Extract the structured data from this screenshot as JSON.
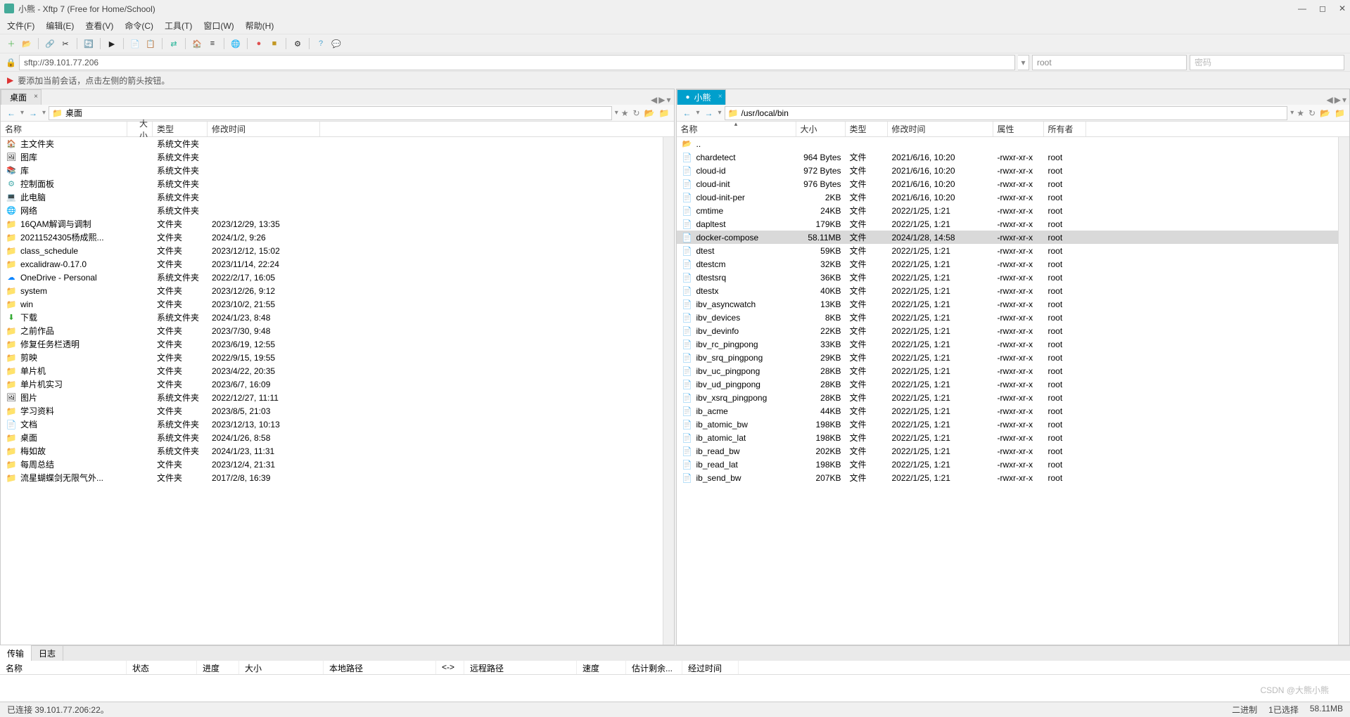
{
  "title": "小熊 - Xftp 7 (Free for Home/School)",
  "menu": [
    "文件(F)",
    "编辑(E)",
    "查看(V)",
    "命令(C)",
    "工具(T)",
    "窗口(W)",
    "帮助(H)"
  ],
  "address": {
    "value": "sftp://39.101.77.206",
    "user": "root",
    "password": "密码"
  },
  "tip": "要添加当前会话，点击左侧的箭头按钮。",
  "left": {
    "tab": "桌面",
    "path_display": "桌面",
    "cols": {
      "name": "名称",
      "size": "大小",
      "type": "类型",
      "mod": "修改时间"
    },
    "rows": [
      {
        "icon": "fi-home",
        "name": "主文件夹",
        "type": "系统文件夹",
        "mod": ""
      },
      {
        "icon": "fi-pic",
        "name": "图库",
        "type": "系统文件夹",
        "mod": ""
      },
      {
        "icon": "fi-lib",
        "name": "库",
        "type": "系统文件夹",
        "mod": ""
      },
      {
        "icon": "fi-panel",
        "name": "控制面板",
        "type": "系统文件夹",
        "mod": ""
      },
      {
        "icon": "fi-pc",
        "name": "此电脑",
        "type": "系统文件夹",
        "mod": ""
      },
      {
        "icon": "fi-net",
        "name": "网络",
        "type": "系统文件夹",
        "mod": ""
      },
      {
        "icon": "fi-folder",
        "name": "16QAM解调与调制",
        "type": "文件夹",
        "mod": "2023/12/29, 13:35"
      },
      {
        "icon": "fi-folder",
        "name": "20211524305杨成熙...",
        "type": "文件夹",
        "mod": "2024/1/2, 9:26"
      },
      {
        "icon": "fi-folder",
        "name": "class_schedule",
        "type": "文件夹",
        "mod": "2023/12/12, 15:02"
      },
      {
        "icon": "fi-folder",
        "name": "excalidraw-0.17.0",
        "type": "文件夹",
        "mod": "2023/11/14, 22:24"
      },
      {
        "icon": "fi-cloud",
        "name": "OneDrive - Personal",
        "type": "系统文件夹",
        "mod": "2022/2/17, 16:05"
      },
      {
        "icon": "fi-folder",
        "name": "system",
        "type": "文件夹",
        "mod": "2023/12/26, 9:12"
      },
      {
        "icon": "fi-folder",
        "name": "win",
        "type": "文件夹",
        "mod": "2023/10/2, 21:55"
      },
      {
        "icon": "fi-down",
        "name": "下载",
        "type": "系统文件夹",
        "mod": "2024/1/23, 8:48"
      },
      {
        "icon": "fi-folder",
        "name": "之前作品",
        "type": "文件夹",
        "mod": "2023/7/30, 9:48"
      },
      {
        "icon": "fi-folder",
        "name": "修复任务栏透明",
        "type": "文件夹",
        "mod": "2023/6/19, 12:55"
      },
      {
        "icon": "fi-folder",
        "name": "剪映",
        "type": "文件夹",
        "mod": "2022/9/15, 19:55"
      },
      {
        "icon": "fi-folder",
        "name": "单片机",
        "type": "文件夹",
        "mod": "2023/4/22, 20:35"
      },
      {
        "icon": "fi-folder",
        "name": "单片机实习",
        "type": "文件夹",
        "mod": "2023/6/7, 16:09"
      },
      {
        "icon": "fi-pic",
        "name": "图片",
        "type": "系统文件夹",
        "mod": "2022/12/27, 11:11"
      },
      {
        "icon": "fi-folder",
        "name": "学习资料",
        "type": "文件夹",
        "mod": "2023/8/5, 21:03"
      },
      {
        "icon": "fi-file",
        "name": "文档",
        "type": "系统文件夹",
        "mod": "2023/12/13, 10:13"
      },
      {
        "icon": "fi-folder",
        "name": "桌面",
        "type": "系统文件夹",
        "mod": "2024/1/26, 8:58"
      },
      {
        "icon": "fi-folder",
        "name": "梅如故",
        "type": "系统文件夹",
        "mod": "2024/1/23, 11:31"
      },
      {
        "icon": "fi-folder",
        "name": "每周总结",
        "type": "文件夹",
        "mod": "2023/12/4, 21:31"
      },
      {
        "icon": "fi-folder",
        "name": "流星蝴蝶剑无限气外...",
        "type": "文件夹",
        "mod": "2017/2/8, 16:39"
      }
    ]
  },
  "right": {
    "tab": "小熊",
    "path_display": "/usr/local/bin",
    "cols": {
      "name": "名称",
      "size": "大小",
      "type": "类型",
      "mod": "修改时间",
      "attr": "属性",
      "owner": "所有者"
    },
    "parent": "..",
    "rows": [
      {
        "name": "chardetect",
        "size": "964 Bytes",
        "type": "文件",
        "mod": "2021/6/16, 10:20",
        "attr": "-rwxr-xr-x",
        "owner": "root"
      },
      {
        "name": "cloud-id",
        "size": "972 Bytes",
        "type": "文件",
        "mod": "2021/6/16, 10:20",
        "attr": "-rwxr-xr-x",
        "owner": "root"
      },
      {
        "name": "cloud-init",
        "size": "976 Bytes",
        "type": "文件",
        "mod": "2021/6/16, 10:20",
        "attr": "-rwxr-xr-x",
        "owner": "root"
      },
      {
        "name": "cloud-init-per",
        "size": "2KB",
        "type": "文件",
        "mod": "2021/6/16, 10:20",
        "attr": "-rwxr-xr-x",
        "owner": "root"
      },
      {
        "name": "cmtime",
        "size": "24KB",
        "type": "文件",
        "mod": "2022/1/25, 1:21",
        "attr": "-rwxr-xr-x",
        "owner": "root"
      },
      {
        "name": "dapltest",
        "size": "179KB",
        "type": "文件",
        "mod": "2022/1/25, 1:21",
        "attr": "-rwxr-xr-x",
        "owner": "root"
      },
      {
        "name": "docker-compose",
        "size": "58.11MB",
        "type": "文件",
        "mod": "2024/1/28, 14:58",
        "attr": "-rwxr-xr-x",
        "owner": "root",
        "selected": true
      },
      {
        "name": "dtest",
        "size": "59KB",
        "type": "文件",
        "mod": "2022/1/25, 1:21",
        "attr": "-rwxr-xr-x",
        "owner": "root"
      },
      {
        "name": "dtestcm",
        "size": "32KB",
        "type": "文件",
        "mod": "2022/1/25, 1:21",
        "attr": "-rwxr-xr-x",
        "owner": "root"
      },
      {
        "name": "dtestsrq",
        "size": "36KB",
        "type": "文件",
        "mod": "2022/1/25, 1:21",
        "attr": "-rwxr-xr-x",
        "owner": "root"
      },
      {
        "name": "dtestx",
        "size": "40KB",
        "type": "文件",
        "mod": "2022/1/25, 1:21",
        "attr": "-rwxr-xr-x",
        "owner": "root"
      },
      {
        "name": "ibv_asyncwatch",
        "size": "13KB",
        "type": "文件",
        "mod": "2022/1/25, 1:21",
        "attr": "-rwxr-xr-x",
        "owner": "root"
      },
      {
        "name": "ibv_devices",
        "size": "8KB",
        "type": "文件",
        "mod": "2022/1/25, 1:21",
        "attr": "-rwxr-xr-x",
        "owner": "root"
      },
      {
        "name": "ibv_devinfo",
        "size": "22KB",
        "type": "文件",
        "mod": "2022/1/25, 1:21",
        "attr": "-rwxr-xr-x",
        "owner": "root"
      },
      {
        "name": "ibv_rc_pingpong",
        "size": "33KB",
        "type": "文件",
        "mod": "2022/1/25, 1:21",
        "attr": "-rwxr-xr-x",
        "owner": "root"
      },
      {
        "name": "ibv_srq_pingpong",
        "size": "29KB",
        "type": "文件",
        "mod": "2022/1/25, 1:21",
        "attr": "-rwxr-xr-x",
        "owner": "root"
      },
      {
        "name": "ibv_uc_pingpong",
        "size": "28KB",
        "type": "文件",
        "mod": "2022/1/25, 1:21",
        "attr": "-rwxr-xr-x",
        "owner": "root"
      },
      {
        "name": "ibv_ud_pingpong",
        "size": "28KB",
        "type": "文件",
        "mod": "2022/1/25, 1:21",
        "attr": "-rwxr-xr-x",
        "owner": "root"
      },
      {
        "name": "ibv_xsrq_pingpong",
        "size": "28KB",
        "type": "文件",
        "mod": "2022/1/25, 1:21",
        "attr": "-rwxr-xr-x",
        "owner": "root"
      },
      {
        "name": "ib_acme",
        "size": "44KB",
        "type": "文件",
        "mod": "2022/1/25, 1:21",
        "attr": "-rwxr-xr-x",
        "owner": "root"
      },
      {
        "name": "ib_atomic_bw",
        "size": "198KB",
        "type": "文件",
        "mod": "2022/1/25, 1:21",
        "attr": "-rwxr-xr-x",
        "owner": "root"
      },
      {
        "name": "ib_atomic_lat",
        "size": "198KB",
        "type": "文件",
        "mod": "2022/1/25, 1:21",
        "attr": "-rwxr-xr-x",
        "owner": "root"
      },
      {
        "name": "ib_read_bw",
        "size": "202KB",
        "type": "文件",
        "mod": "2022/1/25, 1:21",
        "attr": "-rwxr-xr-x",
        "owner": "root"
      },
      {
        "name": "ib_read_lat",
        "size": "198KB",
        "type": "文件",
        "mod": "2022/1/25, 1:21",
        "attr": "-rwxr-xr-x",
        "owner": "root"
      },
      {
        "name": "ib_send_bw",
        "size": "207KB",
        "type": "文件",
        "mod": "2022/1/25, 1:21",
        "attr": "-rwxr-xr-x",
        "owner": "root"
      }
    ]
  },
  "bottom_tabs": {
    "transfer": "传输",
    "log": "日志"
  },
  "transfer_cols": [
    "名称",
    "状态",
    "进度",
    "大小",
    "本地路径",
    "<->",
    "远程路径",
    "速度",
    "估计剩余...",
    "经过时间"
  ],
  "status": {
    "connected": "已连接 39.101.77.206:22。",
    "binary": "二进制",
    "selected": "1已选择",
    "size": "58.11MB"
  },
  "watermark": "CSDN @大熊小熊"
}
